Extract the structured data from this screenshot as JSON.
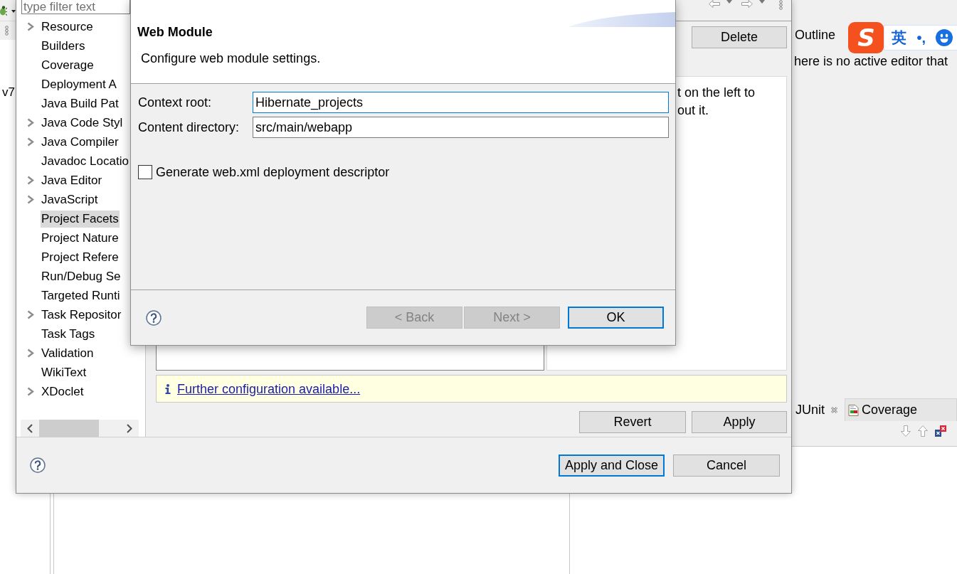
{
  "ide": {
    "left_panel": {
      "text": "v7"
    },
    "outline_view": {
      "tab": {
        "label": "Outline"
      },
      "message": "here is no active editor that"
    },
    "junit_view": {
      "tabs": [
        {
          "label": "JUnit",
          "selected": true
        },
        {
          "label": "Coverage",
          "selected": false
        }
      ]
    }
  },
  "ime_toolbar": {
    "logo": "S",
    "mode": "英",
    "punctuation": "•,"
  },
  "properties_dialog": {
    "filter": {
      "placeholder": "type filter text"
    },
    "tree": [
      {
        "label": "Resource",
        "expandable": true,
        "selected": false
      },
      {
        "label": "Builders",
        "expandable": false,
        "selected": false
      },
      {
        "label": "Coverage",
        "expandable": false,
        "selected": false
      },
      {
        "label": "Deployment A",
        "expandable": false,
        "selected": false
      },
      {
        "label": "Java Build Pat",
        "expandable": false,
        "selected": false
      },
      {
        "label": "Java Code Styl",
        "expandable": true,
        "selected": false
      },
      {
        "label": "Java Compiler",
        "expandable": true,
        "selected": false
      },
      {
        "label": "Javadoc Locatio",
        "expandable": false,
        "selected": false
      },
      {
        "label": "Java Editor",
        "expandable": true,
        "selected": false
      },
      {
        "label": "JavaScript",
        "expandable": true,
        "selected": false
      },
      {
        "label": "Project Facets",
        "expandable": false,
        "selected": true
      },
      {
        "label": "Project Nature",
        "expandable": false,
        "selected": false
      },
      {
        "label": "Project Refere",
        "expandable": false,
        "selected": false
      },
      {
        "label": "Run/Debug Se",
        "expandable": false,
        "selected": false
      },
      {
        "label": "Targeted Runti",
        "expandable": false,
        "selected": false
      },
      {
        "label": "Task Repositor",
        "expandable": true,
        "selected": false
      },
      {
        "label": "Task Tags",
        "expandable": false,
        "selected": false
      },
      {
        "label": "Validation",
        "expandable": true,
        "selected": false
      },
      {
        "label": "WikiText",
        "expandable": false,
        "selected": false
      },
      {
        "label": "XDoclet",
        "expandable": true,
        "selected": false
      }
    ],
    "delete_button": "Delete",
    "details_lines": [
      "t on the left to",
      "out it."
    ],
    "info": {
      "link": "Further configuration available..."
    },
    "actions": [
      "Revert",
      "Apply"
    ],
    "footer_buttons": [
      {
        "label": "Apply and Close",
        "default": true
      },
      {
        "label": "Cancel",
        "default": false
      }
    ]
  },
  "facet_dialog": {
    "title": "Web Module",
    "description": "Configure web module settings.",
    "fields": [
      {
        "label": "Context root:",
        "value": "Hibernate_projects",
        "focused": true
      },
      {
        "label": "Content directory:",
        "value": "src/main/webapp",
        "focused": false
      }
    ],
    "checkbox": {
      "label": "Generate web.xml deployment descriptor",
      "checked": false
    },
    "buttons": [
      {
        "label": "< Back",
        "disabled": true,
        "default": false
      },
      {
        "label": "Next >",
        "disabled": true,
        "default": false
      },
      {
        "label": "OK",
        "disabled": false,
        "default": true
      }
    ]
  }
}
